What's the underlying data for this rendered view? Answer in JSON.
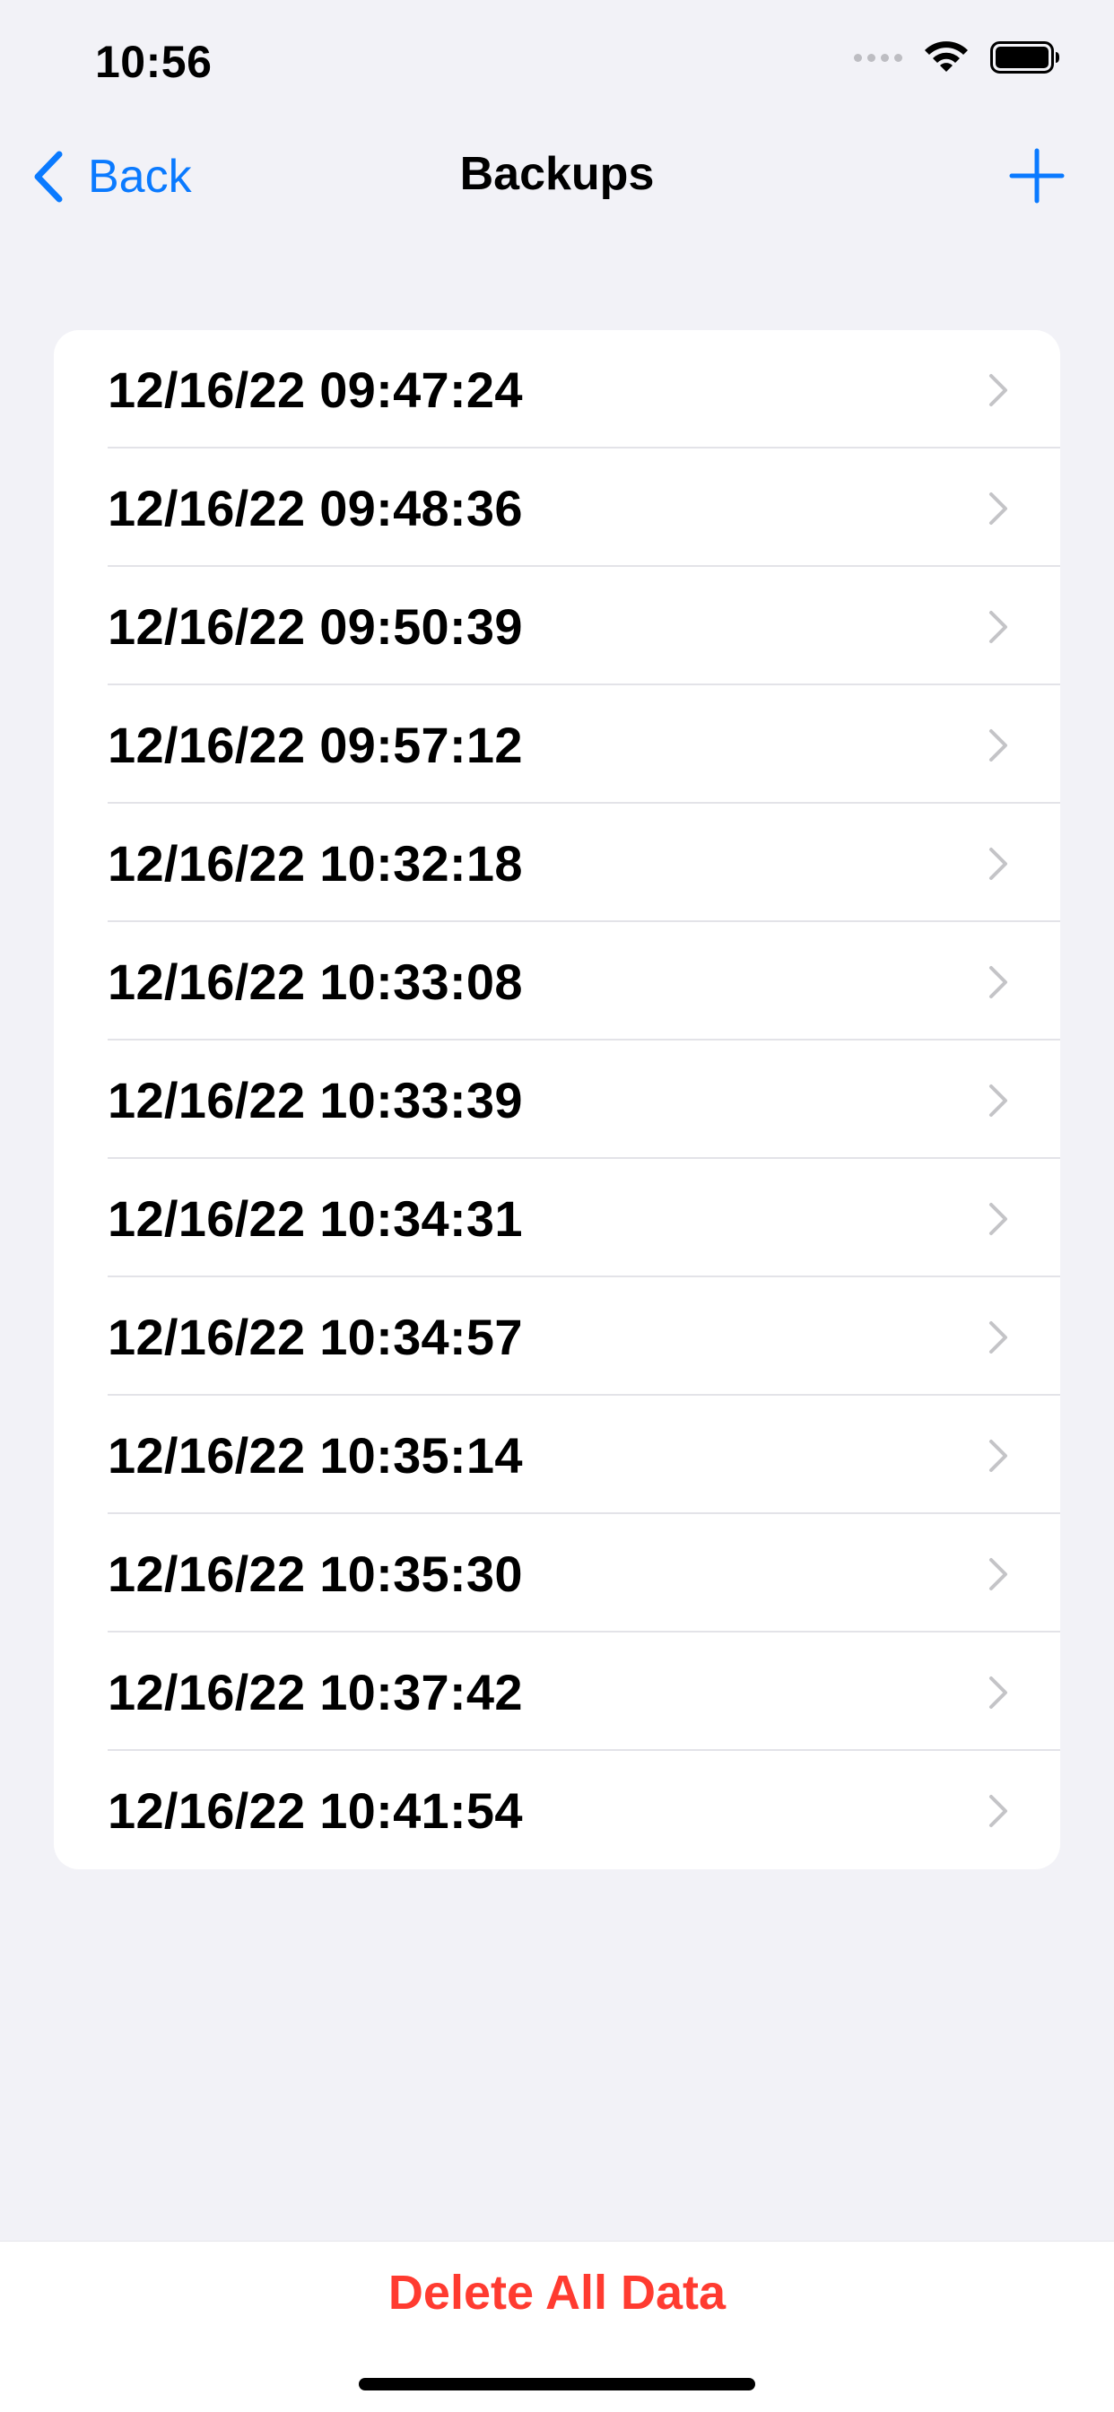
{
  "status_bar": {
    "time": "10:56"
  },
  "nav": {
    "back_label": "Back",
    "title": "Backups",
    "add_icon": "plus-icon",
    "accent_color": "#0A7AFF"
  },
  "backups": [
    "12/16/22 09:47:24",
    "12/16/22 09:48:36",
    "12/16/22 09:50:39",
    "12/16/22 09:57:12",
    "12/16/22 10:32:18",
    "12/16/22 10:33:08",
    "12/16/22 10:33:39",
    "12/16/22 10:34:31",
    "12/16/22 10:34:57",
    "12/16/22 10:35:14",
    "12/16/22 10:35:30",
    "12/16/22 10:37:42",
    "12/16/22 10:41:54"
  ],
  "footer": {
    "delete_label": "Delete All Data",
    "delete_color": "#FF3B30"
  }
}
